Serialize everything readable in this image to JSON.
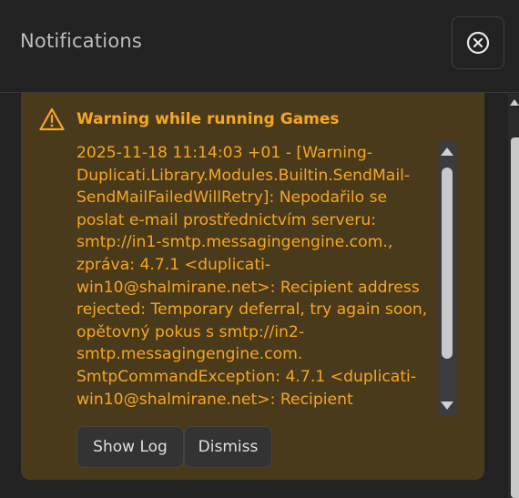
{
  "header": {
    "title": "Notifications",
    "close_icon": "close-circle-icon"
  },
  "notification": {
    "icon": "warning-triangle-icon",
    "title": "Warning while running Games",
    "message": "2025-11-18 11:14:03 +01 - [Warning-Duplicati.Library.Modules.Builtin.SendMail-SendMailFailedWillRetry]: Nepodařilo se poslat e-mail prostřednictvím serveru: smtp://in1-smtp.messagingengine.com., zpráva: 4.7.1 <duplicati-win10@shalmirane.net>: Recipient address rejected: Temporary deferral, try again soon, opětovný pokus s smtp://in2-smtp.messagingengine.com. SmtpCommandException: 4.7.1 <duplicati-win10@shalmirane.net>: Recipient",
    "buttons": {
      "show_log": "Show Log",
      "dismiss": "Dismiss"
    },
    "color": "#f5a623",
    "background": "#4a3a1c"
  }
}
